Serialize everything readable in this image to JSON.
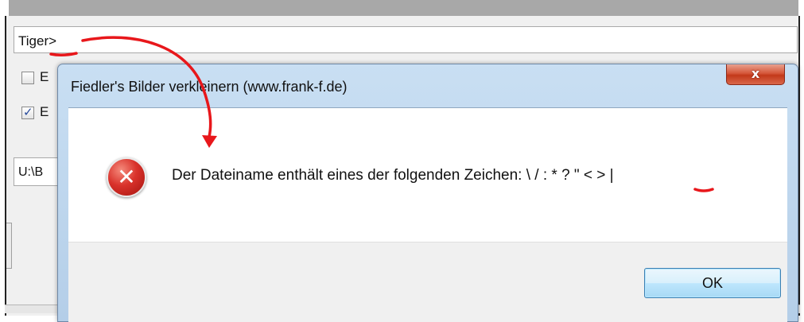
{
  "background_window": {
    "filename_value": "Tiger>",
    "checkbox1_label": "E",
    "checkbox1_checked": false,
    "checkbox2_label": "E",
    "checkbox2_checked": true,
    "path_value": "U:\\B"
  },
  "dialog": {
    "title": "Fiedler's Bilder verkleinern (www.frank-f.de)",
    "close_glyph": "x",
    "icon": "error-icon",
    "message": "Der Dateiname enthält eines der folgenden Zeichen: \\ / : * ? \" < > |",
    "ok_label": "OK"
  },
  "annotations": {
    "color": "#e8171b",
    "arrow": "curved-arrow-from-filename-to-message",
    "underlines": [
      "under-greater-than-in-filename",
      "under-greater-than-in-message"
    ]
  },
  "colors": {
    "dialog_frame": "#b4cee8",
    "close_button": "#c2391a",
    "ok_button_border": "#3c7fb1",
    "error_red": "#d9322b"
  }
}
